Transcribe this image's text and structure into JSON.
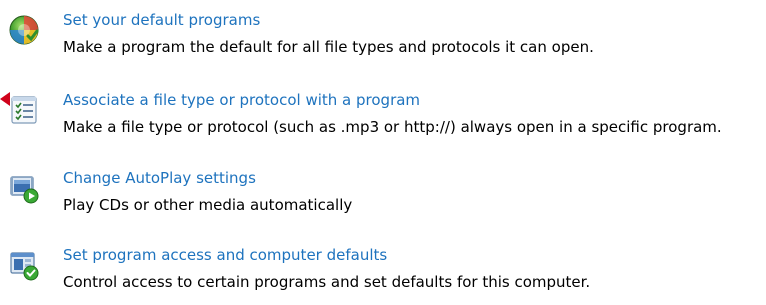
{
  "items": [
    {
      "title": "Set your default programs",
      "description": "Make a program the default for all file types and protocols it can open.",
      "icon": "default-programs-icon"
    },
    {
      "title": "Associate a file type or protocol with a program",
      "description": "Make a file type or protocol (such as .mp3 or http://) always open in a specific program.",
      "icon": "file-association-icon"
    },
    {
      "title": "Change AutoPlay settings",
      "description": "Play CDs or other media automatically",
      "icon": "autoplay-icon"
    },
    {
      "title": "Set program access and computer defaults",
      "description": "Control access to certain programs and set defaults for this computer.",
      "icon": "program-access-icon"
    }
  ],
  "colors": {
    "link": "#1e73be",
    "text": "#000000",
    "pointer": "#d0021b"
  }
}
